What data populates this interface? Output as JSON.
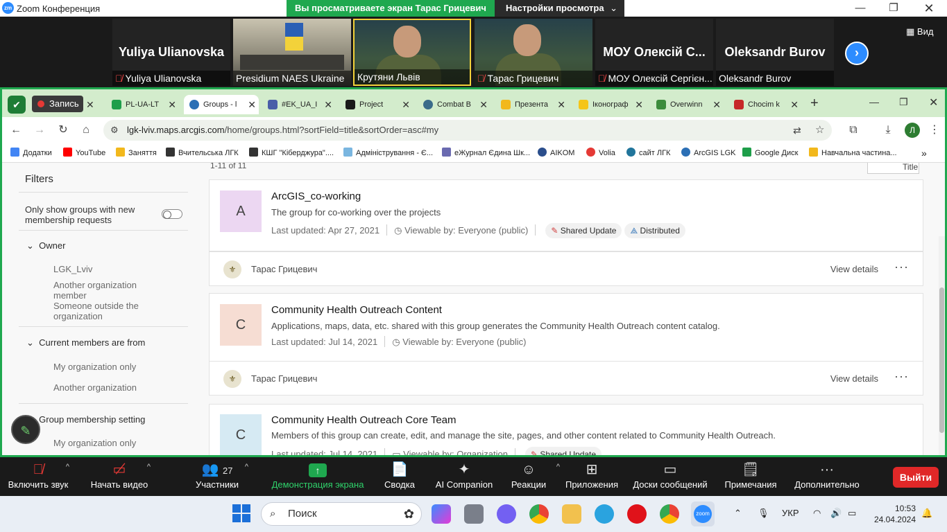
{
  "zoom": {
    "window_title": "Zoom Конференция",
    "logo_text": "zm",
    "share_banner": "Вы просматриваете экран Тарас Грицевич",
    "view_settings": "Настройки просмотра",
    "view_button": "Вид",
    "participants": [
      {
        "label": "Yuliya Ulianovska",
        "big_name": "Yuliya Ulianovska",
        "muted": true
      },
      {
        "label": "Presidium NAES Ukraine",
        "big_name": "",
        "muted": false
      },
      {
        "label": "Крутяни Львів",
        "big_name": "",
        "muted": false
      },
      {
        "label": "Тарас Грицевич",
        "big_name": "",
        "muted": true
      },
      {
        "label": "МОУ Олексій Сергієн...",
        "big_name": "МОУ Олексій С...",
        "muted": true
      },
      {
        "label": "Oleksandr Burov",
        "big_name": "Oleksandr Burov",
        "muted": false
      }
    ],
    "controls": {
      "mute": "Включить звук",
      "video": "Начать видео",
      "participants": "Участники",
      "participants_count": "27",
      "share": "Демонстрация экрана",
      "summary": "Сводка",
      "ai": "AI Companion",
      "reactions": "Реакции",
      "apps": "Приложения",
      "whiteboards": "Доски сообщений",
      "notes": "Примечания",
      "more": "Дополнительно",
      "leave": "Выйти"
    }
  },
  "browser": {
    "record_label": "Запись",
    "tabs": [
      {
        "label": "PL-UA-LT",
        "color": "#1e9e4a"
      },
      {
        "label": "Groups - l",
        "color": "#2b6fb5"
      },
      {
        "label": "#EK_UA_I",
        "color": "#4a5ea8"
      },
      {
        "label": "Project",
        "color": "#1a1a1a"
      },
      {
        "label": "Combat B",
        "color": "#3a6b8a"
      },
      {
        "label": "Презента",
        "color": "#f2b81c"
      },
      {
        "label": "Іконограф",
        "color": "#f5c518"
      },
      {
        "label": "Overwinn",
        "color": "#3c8c3c"
      },
      {
        "label": "Chocim k",
        "color": "#c62828"
      }
    ],
    "url_host": "lgk-lviv.maps.arcgis.com",
    "url_path": "/home/groups.html?sortField=title&sortOrder=asc#my",
    "profile_initial": "Л",
    "bookmarks": [
      {
        "label": "Додатки",
        "color": "#4285f4"
      },
      {
        "label": "YouTube",
        "color": "#ff0000"
      },
      {
        "label": "Заняття",
        "color": "#f2b81c"
      },
      {
        "label": "Вчительська ЛГК",
        "color": "#333333"
      },
      {
        "label": "КШГ \"Кіберджура\"....",
        "color": "#333333"
      },
      {
        "label": "Адміністрування - Є...",
        "color": "#7ab6e0"
      },
      {
        "label": "еЖурнал Єдина Шк...",
        "color": "#6a6ab0"
      },
      {
        "label": "AIKOM",
        "color": "#2b4e8c"
      },
      {
        "label": "Volia",
        "color": "#e53935"
      },
      {
        "label": "сайт ЛГК",
        "color": "#21759b"
      },
      {
        "label": "ArcGIS LGK",
        "color": "#2b6fb5"
      },
      {
        "label": "Google Диск",
        "color": "#1e9e4a"
      },
      {
        "label": "Навчальна частина...",
        "color": "#f2b81c"
      }
    ]
  },
  "page": {
    "results_count": "1-11 of 11",
    "sort_label": "Title",
    "filters": {
      "title": "Filters",
      "new_requests": "Only show groups with new membership requests",
      "owner": "Owner",
      "owner_options": [
        "LGK_Lviv",
        "Another organization member",
        "Someone outside the organization"
      ],
      "members_from": "Current members are from",
      "members_options": [
        "My organization only",
        "Another organization"
      ],
      "membership_setting": "Group membership setting",
      "membership_options": [
        "My organization only"
      ]
    },
    "groups": [
      {
        "letter": "A",
        "thumb_color": "#ecd7f2",
        "title": "ArcGIS_co-working",
        "description": "The group for co-working over the projects",
        "updated": "Last updated: Apr 27, 2021",
        "viewable": "Viewable by: Everyone (public)",
        "chips": [
          "Shared Update",
          "Distributed"
        ],
        "owner": "Тарас Грицевич",
        "view_details": "View details"
      },
      {
        "letter": "C",
        "thumb_color": "#f6ddd3",
        "title": "Community Health Outreach Content",
        "description": "Applications, maps, data, etc. shared with this group generates the Community Health Outreach content catalog.",
        "updated": "Last updated: Jul 14, 2021",
        "viewable": "Viewable by: Everyone (public)",
        "chips": [],
        "owner": "Тарас Грицевич",
        "view_details": "View details"
      },
      {
        "letter": "C",
        "thumb_color": "#d6eaf3",
        "title": "Community Health Outreach Core Team",
        "description": "Members of this group can create, edit, and manage the site, pages, and other content related to Community Health Outreach.",
        "updated": "Last updated: Jul 14, 2021",
        "viewable": "Viewable by: Organization",
        "chips": [
          "Shared Update"
        ]
      }
    ]
  },
  "taskbar": {
    "search": "Поиск",
    "lang": "УКР",
    "time": "10:53",
    "date": "24.04.2024"
  }
}
